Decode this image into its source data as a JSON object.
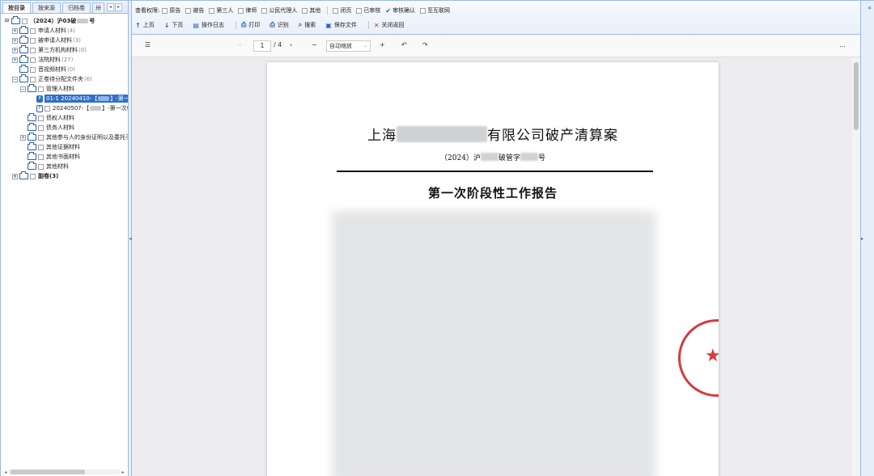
{
  "left_panel": {
    "tabs": [
      "按目录",
      "按来源",
      "归档卷",
      "卅"
    ],
    "tree": [
      {
        "label": "（2024）沪03破",
        "suffix": "号",
        "count": "",
        "expander": "⊟",
        "redact": true
      },
      {
        "label": "申请人材料",
        "count": "(4)",
        "expander": "⊞"
      },
      {
        "label": "被申请人材料",
        "count": "(3)",
        "expander": "⊞"
      },
      {
        "label": "第三方机构材料",
        "count": "(0)",
        "expander": "⊞"
      },
      {
        "label": "法院材料",
        "count": "(27)",
        "expander": "⊞"
      },
      {
        "label": "音视频材料",
        "count": "(0)",
        "expander": ""
      },
      {
        "label": "正卷待分配文件夹",
        "count": "(6)",
        "expander": "⊟"
      },
      {
        "label": "管理人材料",
        "count": "",
        "expander": "⊟"
      },
      {
        "label": "01-1 20240410-【",
        "suffix": "】-第一",
        "count": "",
        "expander": ""
      },
      {
        "label": "20240507-【",
        "suffix": "】-第一次债",
        "count": "",
        "expander": ""
      },
      {
        "label": "债权人材料",
        "count": "",
        "expander": ""
      },
      {
        "label": "债务人材料",
        "count": "",
        "expander": ""
      },
      {
        "label": "其他参与人的身份证明以及委托手",
        "count": "",
        "expander": "⊞"
      },
      {
        "label": "其他证据材料",
        "count": "",
        "expander": ""
      },
      {
        "label": "其他书面材料",
        "count": "",
        "expander": ""
      },
      {
        "label": "其他材料",
        "count": "",
        "expander": ""
      },
      {
        "label": "副卷(3)",
        "count": "",
        "expander": "⊞"
      }
    ]
  },
  "toolbar": {
    "perm_label": "查看权限:",
    "perms": [
      "原告",
      "被告",
      "第三人",
      "律师",
      "公民代理人",
      "其他"
    ],
    "flags": [
      {
        "label": "闭页",
        "checked": false
      },
      {
        "label": "已审核",
        "checked": false
      },
      {
        "label": "审核确认",
        "checked": true
      },
      {
        "label": "至互联网",
        "checked": false
      }
    ],
    "actions": [
      {
        "icon": "↑",
        "label": "上页"
      },
      {
        "icon": "↓",
        "label": "下页"
      },
      {
        "icon": "▤",
        "label": "操作日志"
      },
      {
        "icon": "⎙",
        "label": "打印"
      },
      {
        "icon": "⎙",
        "label": "识别"
      },
      {
        "icon": "⌕",
        "label": "搜索"
      },
      {
        "icon": "▣",
        "label": "保存文件"
      },
      {
        "icon": "✕",
        "label": "关闭返回"
      }
    ]
  },
  "viewer": {
    "current_page": "1",
    "total_pages": "/ 4",
    "zoom": "自动缩放"
  },
  "document": {
    "title_prefix": "上海",
    "title_suffix": "有限公司破产清算案",
    "case_prefix": "（2024）沪",
    "case_middle": "破管字",
    "case_suffix": "号",
    "heading": "第一次阶段性工作报告"
  },
  "colors": {
    "accent": "#2f6fc9",
    "panel_border": "#9bbbe0",
    "seal_red": "#d63a3a"
  }
}
